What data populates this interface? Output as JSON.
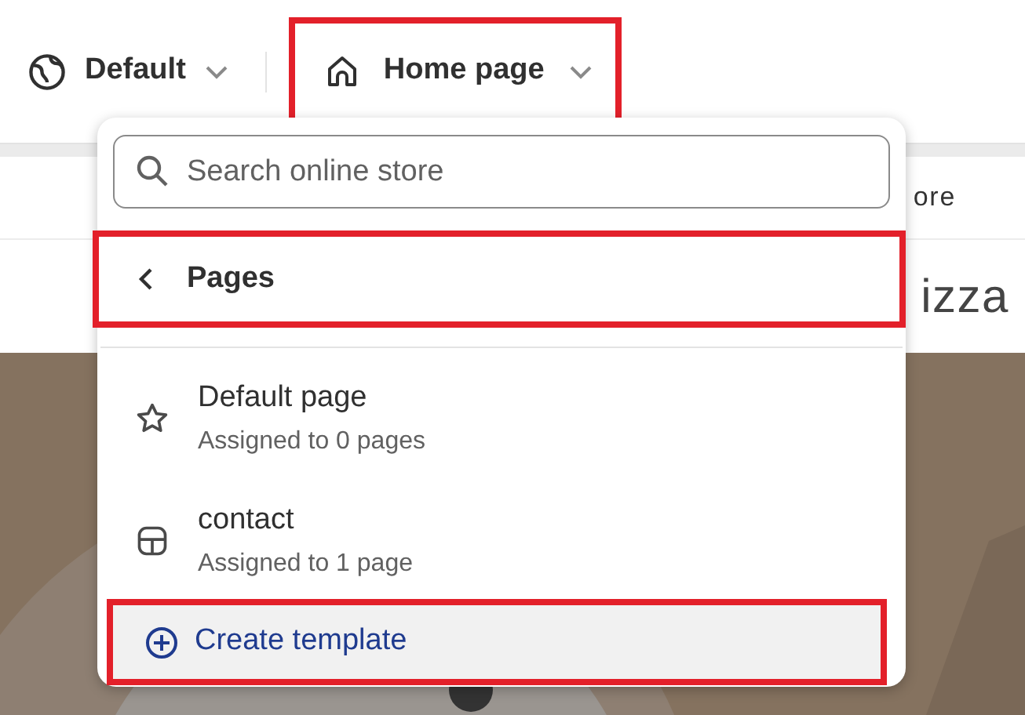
{
  "top_bar": {
    "store_selector": {
      "label": "Default",
      "highlighted": false
    },
    "template_selector": {
      "label": "Home page",
      "highlighted": true
    }
  },
  "preview": {
    "nav_text": "ore",
    "heading": "izza",
    "kind": "picture"
  },
  "dropdown": {
    "search": {
      "placeholder": "Search online store"
    },
    "back_row": {
      "label": "Pages",
      "highlighted": true
    },
    "templates": [
      {
        "name": "Default page",
        "detail": "Assigned to 0 pages",
        "kind": "star"
      },
      {
        "name": "contact",
        "detail": "Assigned to 1 page",
        "kind": "layout"
      }
    ],
    "create": {
      "label": "Create template",
      "highlighted": true
    }
  }
}
